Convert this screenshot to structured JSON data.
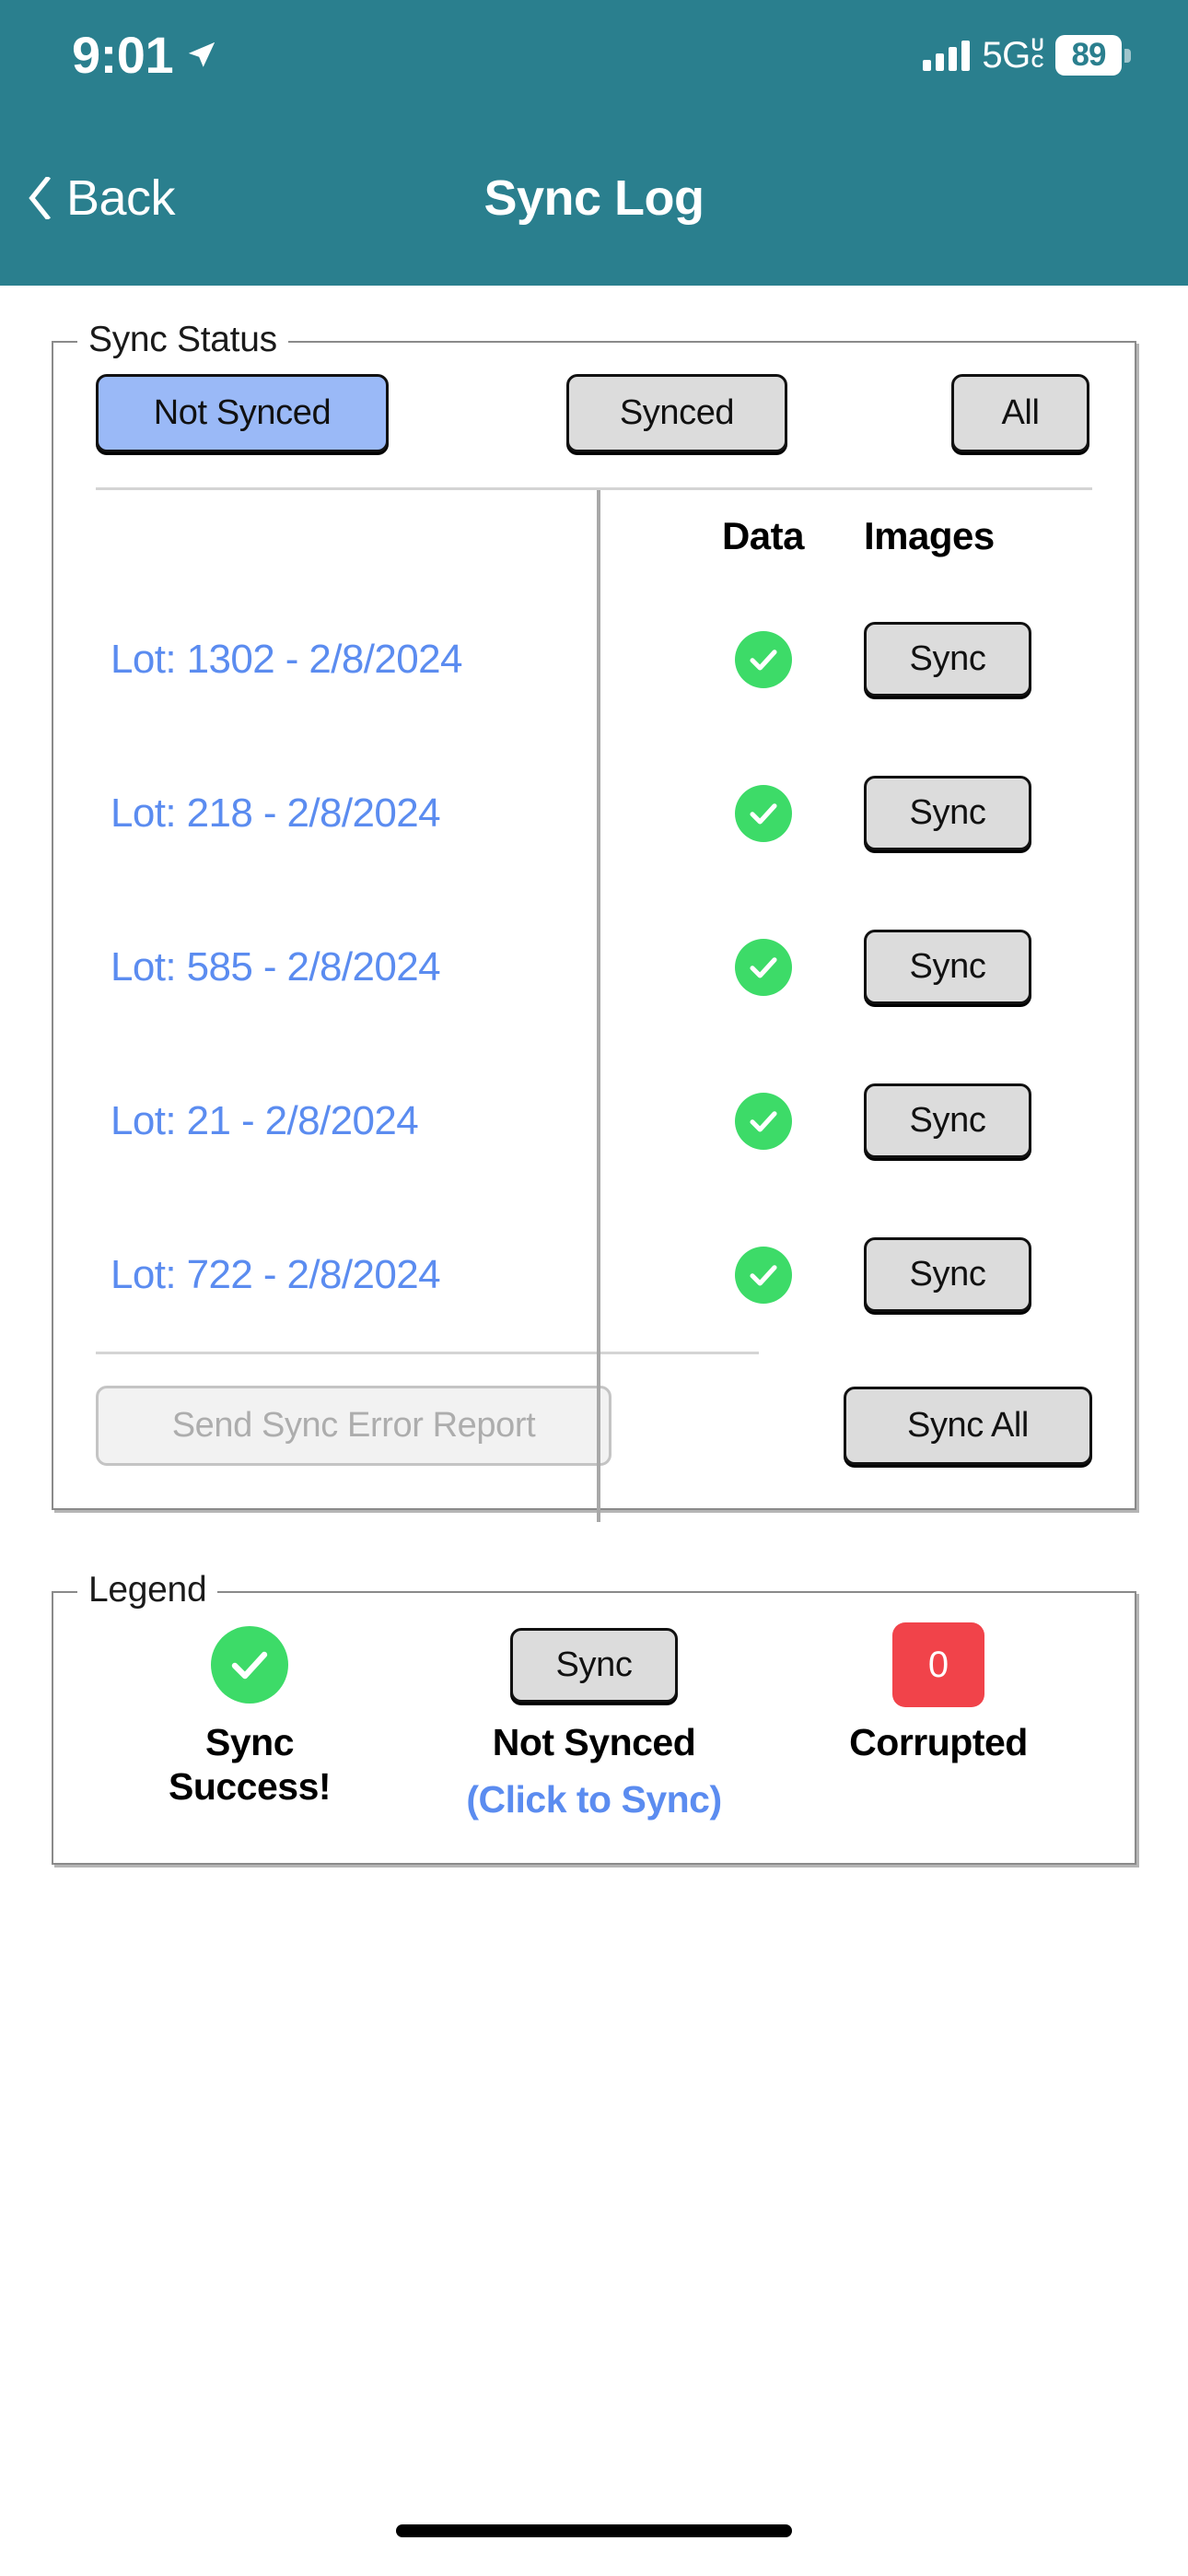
{
  "status_bar": {
    "time": "9:01",
    "location_icon": "location-arrow-icon",
    "signal_icon": "cellular-signal-icon",
    "network": "5G",
    "network_sub_top": "U",
    "network_sub_bottom": "C",
    "battery_level": "89"
  },
  "nav": {
    "back_label": "Back",
    "back_icon": "chevron-left-icon",
    "title": "Sync Log"
  },
  "sync_status": {
    "legend_title": "Sync Status",
    "filters": [
      {
        "label": "Not Synced",
        "selected": true
      },
      {
        "label": "Synced",
        "selected": false
      },
      {
        "label": "All",
        "selected": false
      }
    ],
    "columns": {
      "lot": "",
      "data": "Data",
      "images": "Images"
    },
    "rows": [
      {
        "lot": "Lot: 1302 - 2/8/2024",
        "data_status": "synced",
        "images_action": "Sync"
      },
      {
        "lot": "Lot: 218 - 2/8/2024",
        "data_status": "synced",
        "images_action": "Sync"
      },
      {
        "lot": "Lot: 585 - 2/8/2024",
        "data_status": "synced",
        "images_action": "Sync"
      },
      {
        "lot": "Lot: 21 - 2/8/2024",
        "data_status": "synced",
        "images_action": "Sync"
      },
      {
        "lot": "Lot: 722 - 2/8/2024",
        "data_status": "synced",
        "images_action": "Sync"
      }
    ],
    "send_error_report_label": "Send Sync Error Report",
    "send_error_report_disabled": true,
    "sync_all_label": "Sync All"
  },
  "legend": {
    "legend_title": "Legend",
    "items": [
      {
        "icon": "green-check-icon",
        "label": "Sync\nSuccess!",
        "label_line1": "Sync",
        "label_line2": "Success!",
        "sub": ""
      },
      {
        "icon": "sync-button-icon",
        "button_label": "Sync",
        "label_line1": "Not Synced",
        "sub": "(Click to Sync)"
      },
      {
        "icon": "red-count-badge",
        "badge_value": "0",
        "label_line1": "Corrupted",
        "sub": ""
      }
    ]
  },
  "colors": {
    "header_teal": "#2a7f8e",
    "link_blue": "#5b8cf0",
    "selected_filter_blue": "#9ab9f7",
    "success_green": "#3ddb68",
    "corrupt_red": "#f1434a",
    "button_gray": "#dcdcdc"
  }
}
